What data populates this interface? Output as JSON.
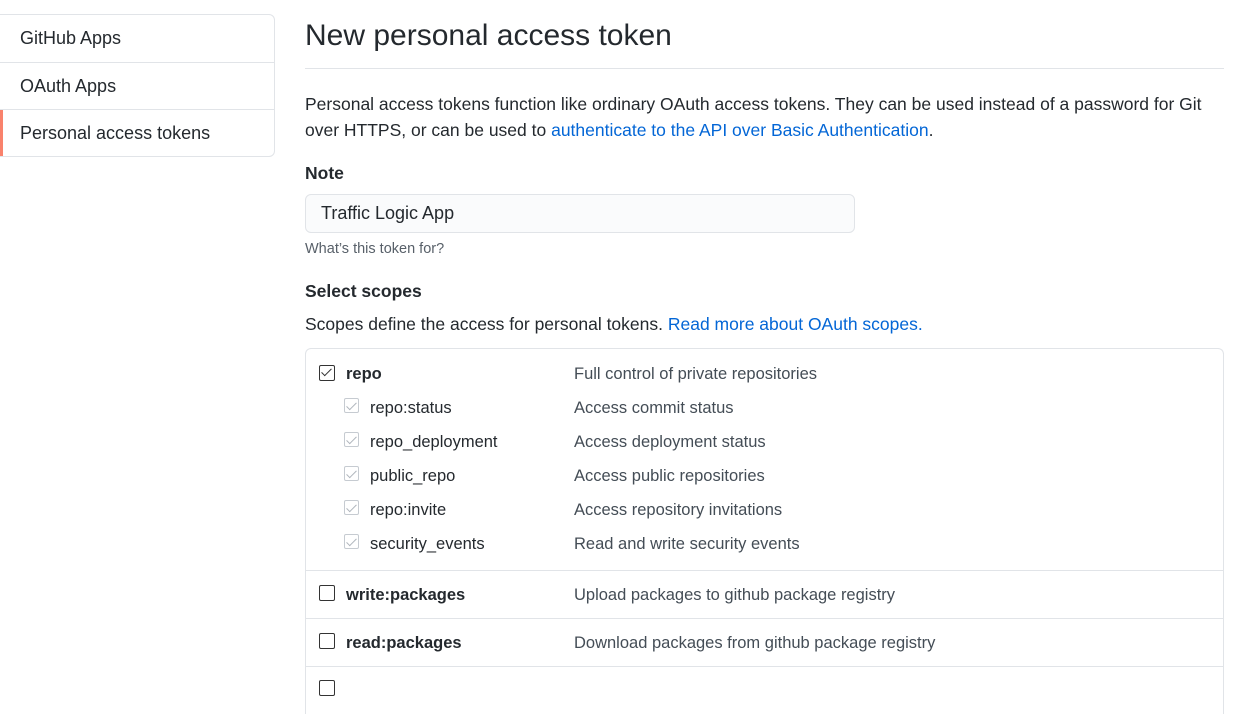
{
  "sidebar": {
    "items": [
      {
        "label": "GitHub Apps",
        "selected": false
      },
      {
        "label": "OAuth Apps",
        "selected": false
      },
      {
        "label": "Personal access tokens",
        "selected": true
      }
    ]
  },
  "page": {
    "title": "New personal access token",
    "intro_text": "Personal access tokens function like ordinary OAuth access tokens. They can be used instead of a password for Git over HTTPS, or can be used to ",
    "intro_link": "authenticate to the API over Basic Authentication",
    "intro_end": "."
  },
  "note": {
    "label": "Note",
    "value": "Traffic Logic App",
    "hint": "What’s this token for?"
  },
  "scopes": {
    "title": "Select scopes",
    "desc_text": "Scopes define the access for personal tokens. ",
    "desc_link": "Read more about OAuth scopes.",
    "groups": [
      {
        "name": "repo",
        "desc": "Full control of private repositories",
        "checked": true,
        "children": [
          {
            "name": "repo:status",
            "desc": "Access commit status",
            "checked": true
          },
          {
            "name": "repo_deployment",
            "desc": "Access deployment status",
            "checked": true
          },
          {
            "name": "public_repo",
            "desc": "Access public repositories",
            "checked": true
          },
          {
            "name": "repo:invite",
            "desc": "Access repository invitations",
            "checked": true
          },
          {
            "name": "security_events",
            "desc": "Read and write security events",
            "checked": true
          }
        ]
      },
      {
        "name": "write:packages",
        "desc": "Upload packages to github package registry",
        "checked": false,
        "children": []
      },
      {
        "name": "read:packages",
        "desc": "Download packages from github package registry",
        "checked": false,
        "children": []
      }
    ]
  },
  "colors": {
    "link": "#0366d6",
    "selected_indicator": "#f9826c",
    "border": "#e1e4e8"
  }
}
